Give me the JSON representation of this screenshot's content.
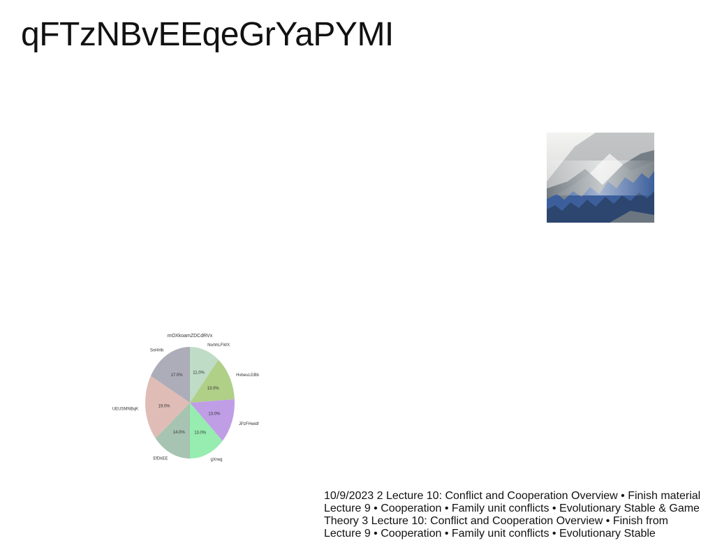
{
  "slide": {
    "title": "qFTzNBvEEqeGrYaPYMI",
    "body_text": "10/9/2023 2 Lecture 10: Conflict and Cooperation Overview • Finish material Lecture 9 • Cooperation • Family unit conflicts • Evolutionary Stable & Game Theory 3 Lecture 10: Conflict and Cooperation Overview • Finish from Lecture 9 • Cooperation • Family unit conflicts • Evolutionary Stable"
  },
  "photo": {
    "subject": "misty mountain forest",
    "colors": {
      "sky": "#e9e9e6",
      "mist": "#b9bcbf",
      "forest": "#3c5f9c",
      "ridge": "#4f5a62"
    }
  },
  "chart_data": {
    "type": "pie",
    "title": "mOXkoamZDCdRVx",
    "categories": [
      "NixhhLFWX",
      "HvbeuLGBb",
      "JPzFHwldf",
      "gXrwg",
      "EfDkEE",
      "UEUSMNBqK",
      "SnHHb"
    ],
    "values": [
      11.0,
      13.0,
      13.0,
      13.0,
      14.0,
      19.0,
      17.0
    ],
    "value_labels": [
      "11.0%",
      "13.0%",
      "13.0%",
      "13.0%",
      "14.0%",
      "19.0%",
      "17.0%"
    ],
    "colors": [
      "#bfdcc6",
      "#b0cf87",
      "#bf9ee6",
      "#97ecb0",
      "#a7c3b1",
      "#dfbdb6",
      "#adadb9"
    ],
    "start_angle": 90,
    "direction": "clockwise"
  }
}
